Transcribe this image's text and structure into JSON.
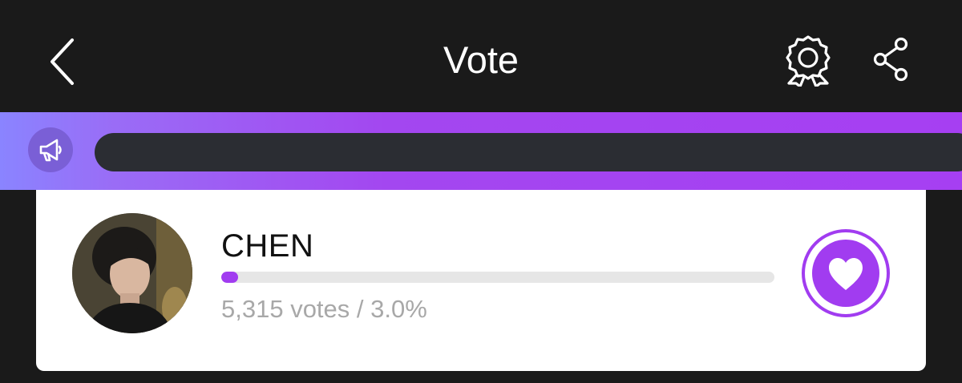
{
  "header": {
    "title": "Vote",
    "back_icon": "chevron-left-icon",
    "award_icon": "award-ribbon-icon",
    "share_icon": "share-icon"
  },
  "banner": {
    "icon": "megaphone-icon",
    "text": ""
  },
  "candidate": {
    "name": "CHEN",
    "stats": "5,315 votes / 3.0%",
    "share_percent": 3.0,
    "vote_icon": "heart-icon"
  },
  "colors": {
    "background": "#1a1a1a",
    "accent": "#a13cf0",
    "banner_start": "#8a84ff",
    "banner_end": "#a63ff2",
    "marquee_bg": "#2b2d33",
    "card": "#ffffff",
    "stats_text": "#a8a8a8"
  }
}
